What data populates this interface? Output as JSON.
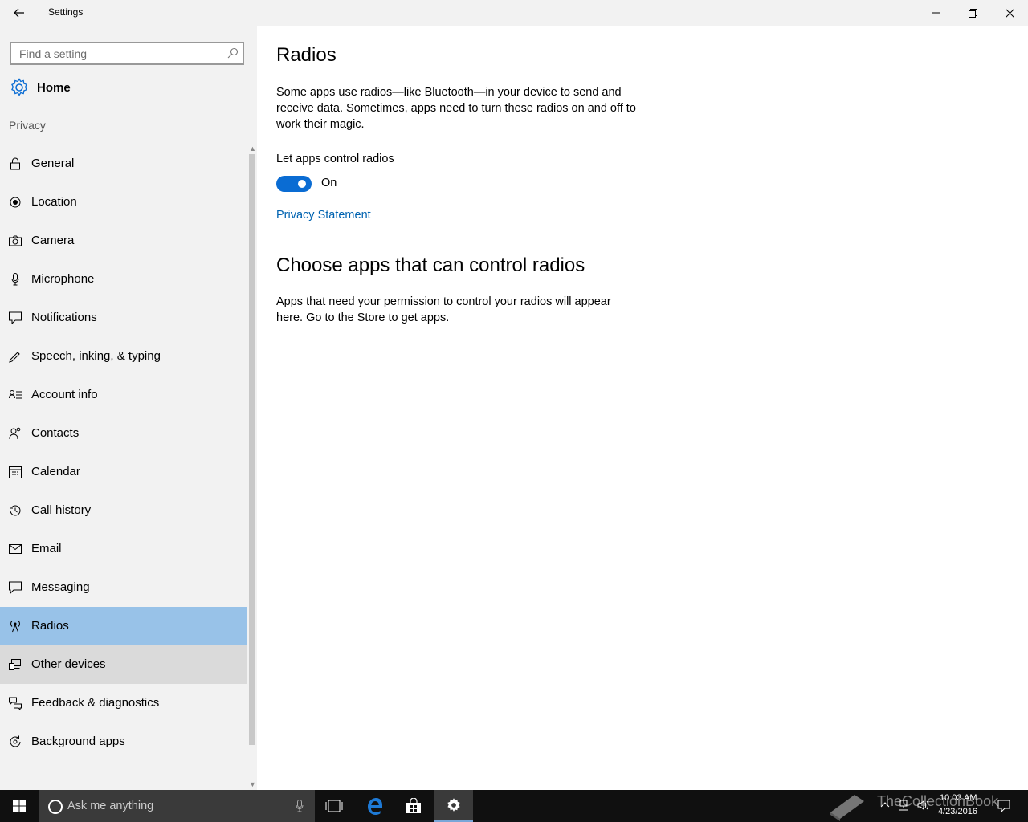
{
  "window": {
    "title": "Settings",
    "back_label": "Back",
    "minimize": "Minimize",
    "maximize": "Restore",
    "close": "Close"
  },
  "sidebar": {
    "search_placeholder": "Find a setting",
    "home_label": "Home",
    "section_label": "Privacy",
    "items": [
      {
        "label": "General",
        "icon": "lock-icon"
      },
      {
        "label": "Location",
        "icon": "location-icon"
      },
      {
        "label": "Camera",
        "icon": "camera-icon"
      },
      {
        "label": "Microphone",
        "icon": "microphone-icon"
      },
      {
        "label": "Notifications",
        "icon": "notifications-icon"
      },
      {
        "label": "Speech, inking, & typing",
        "icon": "speech-icon"
      },
      {
        "label": "Account info",
        "icon": "account-info-icon"
      },
      {
        "label": "Contacts",
        "icon": "contacts-icon"
      },
      {
        "label": "Calendar",
        "icon": "calendar-icon"
      },
      {
        "label": "Call history",
        "icon": "call-history-icon"
      },
      {
        "label": "Email",
        "icon": "email-icon"
      },
      {
        "label": "Messaging",
        "icon": "messaging-icon"
      },
      {
        "label": "Radios",
        "icon": "radios-icon",
        "selected": true
      },
      {
        "label": "Other devices",
        "icon": "other-devices-icon",
        "hover": true
      },
      {
        "label": "Feedback & diagnostics",
        "icon": "feedback-icon"
      },
      {
        "label": "Background apps",
        "icon": "background-apps-icon"
      }
    ]
  },
  "main": {
    "title": "Radios",
    "description": "Some apps use radios—like Bluetooth—in your device to send and receive data. Sometimes, apps need to turn these radios on and off to work their magic.",
    "toggle_label": "Let apps control radios",
    "toggle_state": "On",
    "toggle_on": true,
    "link_label": "Privacy Statement",
    "section_title": "Choose apps that can control radios",
    "section_description": "Apps that need your permission to control your radios will appear here. Go to the Store to get apps."
  },
  "taskbar": {
    "search_placeholder": "Ask me anything",
    "watermark": "TheCollectionBook",
    "time": "10:03 AM",
    "date": "4/23/2016"
  },
  "colors": {
    "accent": "#0a6cd3",
    "selected_bg": "#98c2e8",
    "link": "#0063b1",
    "sidebar_bg": "#f2f2f2"
  }
}
